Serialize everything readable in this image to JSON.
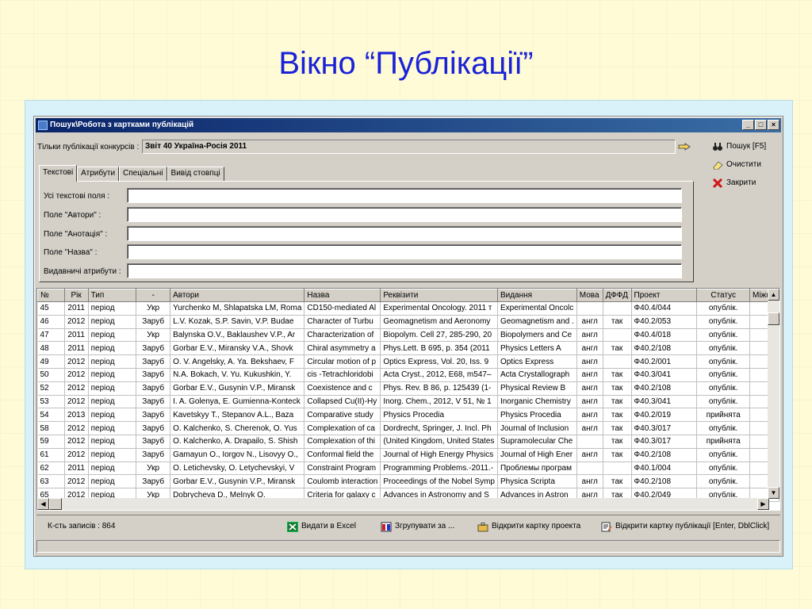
{
  "slide_title": "Вікно “Публікації”",
  "window": {
    "title": "Пошук\\Робота з картками публікацій",
    "buttons": [
      "_",
      "□",
      "×"
    ]
  },
  "filter": {
    "label": "Тільки публікації конкурсів :",
    "value": "Звіт 40 Україна-Росія 2011"
  },
  "actions": {
    "search": "Пошук [F5]",
    "clear": "Очистити",
    "close": "Закрити"
  },
  "tabs": [
    "Текстові",
    "Атрибути",
    "Спеціальні",
    "Вивід стовпці"
  ],
  "fields": {
    "all_text": "Усі текстові поля :",
    "authors": "Поле \"Автори\" :",
    "abstract": "Поле \"Анотація\" :",
    "name": "Поле \"Назва\" :",
    "visible_attrs": "Видавничі атрибути :"
  },
  "table": {
    "columns": [
      "№",
      "Рік",
      "Тип",
      "-",
      "Автори",
      "Назва",
      "Реквізити",
      "Видання",
      "Мова",
      "ДФФД",
      "Проект",
      "Статус",
      "Міжн"
    ],
    "rows": [
      [
        "45",
        "2011",
        "період",
        "Укр",
        "Yurchenko M, Shlapatska LM, Roma",
        "CD150-mediated Al",
        "Experimental Oncology. 2011 т",
        "Experimental Oncolc",
        "",
        "",
        "Ф40.4/044",
        "опублік.",
        ""
      ],
      [
        "46",
        "2012",
        "період",
        "Заруб",
        "L.V. Kozak, S.P. Savin, V.P. Budae",
        "Character of Turbu",
        "Geomagnetism and Aeronomy",
        "Geomagnetism and .",
        "англ",
        "так",
        "Ф40.2/053",
        "опублік.",
        ""
      ],
      [
        "47",
        "2011",
        "період",
        "Укр",
        "Balynska O.V., Baklaushev V.P., Ar",
        "Characterization of",
        "Biopolym. Cell 27, 285-290, 20",
        "Biopolymers and Ce",
        "англ",
        "",
        "Ф40.4/018",
        "опублік.",
        ""
      ],
      [
        "48",
        "2011",
        "період",
        "Заруб",
        "Gorbar E.V., Miransky V.A., Shovk",
        "Chiral asymmetry a",
        "Phys.Lett. B 695, p. 354 (2011",
        "Physics Letters A",
        "англ",
        "так",
        "Ф40.2/108",
        "опублік.",
        ""
      ],
      [
        "49",
        "2012",
        "період",
        "Заруб",
        "O. V. Angelsky, A. Ya. Bekshaev, F",
        "Circular motion of p",
        "Optics Express, Vol. 20, Iss. 9",
        "Optics Express",
        "англ",
        "",
        "Ф40.2/001",
        "опублік.",
        ""
      ],
      [
        "50",
        "2012",
        "період",
        "Заруб",
        "N.A. Bokach, V. Yu. Kukushkin, Y.",
        "cis -Tetrachloridobi",
        "Acta Cryst., 2012, E68, m547–",
        "Acta Crystallograph",
        "англ",
        "так",
        "Ф40.3/041",
        "опублік.",
        ""
      ],
      [
        "52",
        "2012",
        "період",
        "Заруб",
        "Gorbar E.V., Gusynin V.P., Miransk",
        "Coexistence and c",
        "Phys. Rev. B 86, p. 125439 (1-",
        "Physical Review B",
        "англ",
        "так",
        "Ф40.2/108",
        "опублік.",
        ""
      ],
      [
        "53",
        "2012",
        "період",
        "Заруб",
        "I. A. Golenya, E. Gumienna-Konteck",
        "Collapsed Cu(II)-Hy",
        "Inorg. Chem., 2012, V 51, № 1",
        "Inorganic Chemistry",
        "англ",
        "так",
        "Ф40.3/041",
        "опублік.",
        ""
      ],
      [
        "54",
        "2013",
        "період",
        "Заруб",
        "Kavetskyy T., Stepanov A.L., Baza",
        "Comparative study",
        "Physics Procedia",
        "Physics Procedia",
        "англ",
        "так",
        "Ф40.2/019",
        "прийнята",
        ""
      ],
      [
        "58",
        "2012",
        "період",
        "Заруб",
        "O. Kalchenko, S. Cherenok, O. Yus",
        "Complexation of ca",
        "Dordrecht, Springer, J. Incl. Ph",
        "Journal of Inclusion",
        "англ",
        "так",
        "Ф40.3/017",
        "опублік.",
        ""
      ],
      [
        "59",
        "2012",
        "період",
        "Заруб",
        "O. Kalchenko, A. Drapailo, S. Shish",
        "Complexation of thi",
        "(United Kingdom, United States",
        "Supramolecular Che",
        "",
        "так",
        "Ф40.3/017",
        "прийнята",
        ""
      ],
      [
        "61",
        "2012",
        "період",
        "Заруб",
        "Gamayun O., Iorgov N., Lisovyy O.,",
        "Conformal field the",
        "Journal of High Energy Physics",
        "Journal of High Ener",
        "англ",
        "так",
        "Ф40.2/108",
        "опублік.",
        ""
      ],
      [
        "62",
        "2011",
        "період",
        "Укр",
        "O. Letichevsky, O. Letychevskyi, V",
        "Constraint Program",
        "Programming Problems.-2011.-",
        "Проблемы програм",
        "",
        "",
        "Ф40.1/004",
        "опублік.",
        ""
      ],
      [
        "63",
        "2012",
        "період",
        "Заруб",
        "Gorbar E.V., Gusynin V.P., Miransk",
        "Coulomb interaction",
        "Proceedings of the Nobel Symp",
        "Physica Scripta",
        "англ",
        "так",
        "Ф40.2/108",
        "опублік.",
        ""
      ],
      [
        "65",
        "2012",
        "період",
        "Укр",
        "Dobrycheva D., Melnyk O.",
        "Criteria for galaxy c",
        "Advances in Astronomy and S",
        "Advances in Astron",
        "англ",
        "так",
        "Ф40.2/049",
        "опублік.",
        ""
      ]
    ]
  },
  "statusbar": {
    "count": "К-сть записів : 864",
    "excel": "Видати в Excel",
    "group": "Згрупувати за ...",
    "open_project": "Відкрити картку проекта",
    "open_pub": "Відкрити картку публікації [Enter, DblClick]"
  }
}
